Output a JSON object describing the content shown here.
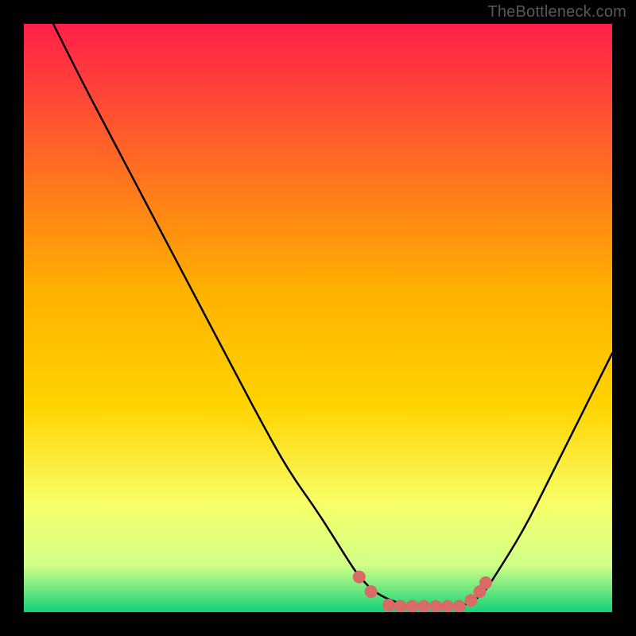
{
  "watermark": "TheBottleneck.com",
  "colors": {
    "border": "#000000",
    "curve": "#000000",
    "marker": "#d86b66",
    "grad_top": "#ff1f4a",
    "grad_mid": "#ffd400",
    "grad_low1": "#f7ff6a",
    "grad_low2": "#d2ff88",
    "grad_bottom": "#12d178"
  },
  "chart_data": {
    "type": "line",
    "title": "",
    "xlabel": "",
    "ylabel": "",
    "xlim": [
      0,
      100
    ],
    "ylim": [
      0,
      100
    ],
    "axes_visible": false,
    "legend": false,
    "grid": false,
    "note": "Bottleneck severity vs. component balance; optimum (minimum) around x≈65–75. Values are percentages of vertical extent read off the curve.",
    "series": [
      {
        "name": "bottleneck-curve",
        "x": [
          5,
          10,
          15,
          20,
          25,
          30,
          35,
          40,
          45,
          50,
          55,
          57,
          60,
          65,
          70,
          75,
          78,
          80,
          85,
          90,
          95,
          100
        ],
        "values": [
          100,
          90,
          80.5,
          71,
          61.5,
          52,
          42.5,
          33,
          24,
          17,
          9,
          6,
          3,
          1,
          1,
          1,
          3,
          6,
          14,
          24,
          34,
          44
        ]
      }
    ],
    "highlight_points": [
      {
        "x": 57,
        "y": 6
      },
      {
        "x": 59,
        "y": 3.5
      },
      {
        "x": 62,
        "y": 1.2
      },
      {
        "x": 64,
        "y": 1
      },
      {
        "x": 66,
        "y": 1
      },
      {
        "x": 68,
        "y": 1
      },
      {
        "x": 70,
        "y": 1
      },
      {
        "x": 72,
        "y": 1
      },
      {
        "x": 74,
        "y": 1
      },
      {
        "x": 76,
        "y": 2
      },
      {
        "x": 77.5,
        "y": 3.5
      },
      {
        "x": 78.5,
        "y": 5
      }
    ]
  }
}
